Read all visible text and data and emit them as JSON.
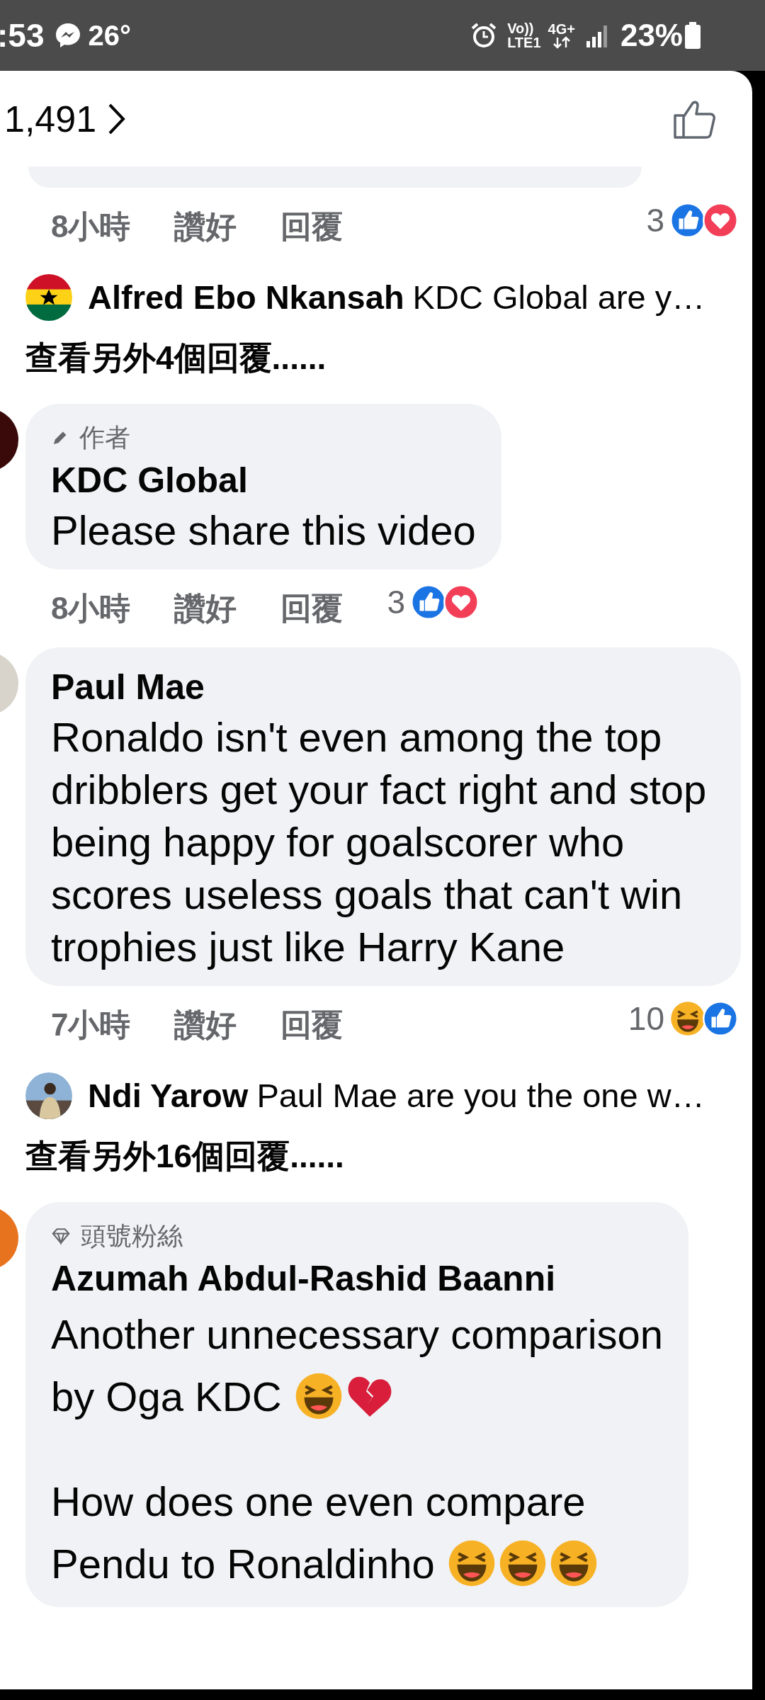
{
  "status_bar": {
    "time": ":53",
    "temperature": "26°",
    "volte": "Vo))",
    "lte": "LTE1",
    "data": "4G+",
    "battery": "23%"
  },
  "header": {
    "reaction_count": "1,491"
  },
  "items": [
    {
      "kind": "actions",
      "time": "8小時",
      "like": "讚好",
      "reply": "回覆",
      "reaction_count": "3"
    },
    {
      "kind": "reply_preview",
      "name": "Alfred Ebo Nkansah",
      "text": "KDC Global are y…"
    },
    {
      "kind": "more_replies",
      "text": "查看另外4個回覆......"
    },
    {
      "kind": "comment",
      "badge": "作者",
      "name": "KDC Global",
      "paragraphs": [
        {
          "lines": [
            "Please share this video"
          ]
        }
      ]
    },
    {
      "kind": "actions",
      "time": "8小時",
      "like": "讚好",
      "reply": "回覆",
      "reaction_count": "3"
    },
    {
      "kind": "comment",
      "name": "Paul Mae",
      "paragraphs": [
        {
          "lines": [
            "Ronaldo isn't even among the top dribblers get your fact right and stop being happy for goalscorer who scores useless goals that can't win trophies just like Harry Kane"
          ]
        }
      ]
    },
    {
      "kind": "actions",
      "time": "7小時",
      "like": "讚好",
      "reply": "回覆",
      "reaction_count": "10"
    },
    {
      "kind": "reply_preview",
      "name": "Ndi Yarow",
      "text": "Paul Mae are you the one w…"
    },
    {
      "kind": "more_replies",
      "text": "查看另外16個回覆......"
    },
    {
      "kind": "comment",
      "badge": "頭號粉絲",
      "name": "Azumah Abdul-Rashid Baanni",
      "paragraphs": [
        {
          "lines": [
            "Another unnecessary comparison",
            "by Oga KDC"
          ]
        },
        {
          "lines": [
            "How does one even compare",
            "Pendu to Ronaldinho"
          ]
        }
      ]
    }
  ]
}
